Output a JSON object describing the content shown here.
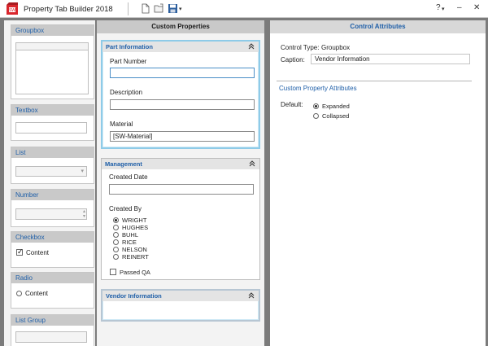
{
  "window": {
    "title": "Property Tab Builder  2018",
    "help_label": "?",
    "help_menu_label": "▾",
    "minimize_label": "–",
    "close_label": "✕"
  },
  "colors": {
    "accent": "#1f5fa8",
    "selection": "#8ecbe8",
    "logo": "#d9262c"
  },
  "palette": {
    "groupbox": {
      "label": "Groupbox"
    },
    "textbox": {
      "label": "Textbox"
    },
    "list": {
      "label": "List",
      "arrow": "▾"
    },
    "number": {
      "label": "Number",
      "spin_up": "▴",
      "spin_down": "▾"
    },
    "checkbox": {
      "label": "Checkbox",
      "item": "Content"
    },
    "radio": {
      "label": "Radio",
      "item": "Content"
    },
    "list_group": {
      "label": "List Group"
    }
  },
  "center": {
    "header": "Custom Properties",
    "part_information": {
      "title": "Part Information",
      "part_number_label": "Part Number",
      "part_number_value": "",
      "description_label": "Description",
      "description_value": "",
      "material_label": "Material",
      "material_value": "[SW-Material]"
    },
    "management": {
      "title": "Management",
      "created_date_label": "Created Date",
      "created_date_value": "",
      "created_by_label": "Created By",
      "options": [
        "WRIGHT",
        "HUGHES",
        "BUHL",
        "RICE",
        "NELSON",
        "REINERT"
      ],
      "selected_option": "WRIGHT",
      "passed_qa_label": "Passed QA",
      "passed_qa_checked": false
    },
    "vendor_information": {
      "title": "Vendor Information"
    }
  },
  "right": {
    "header": "Control Attributes",
    "control_type_label": "Control Type:",
    "control_type_value": "Groupbox",
    "caption_label": "Caption:",
    "caption_value": "Vendor Information",
    "custom_section_title": "Custom Property Attributes",
    "default_label": "Default:",
    "expanded_label": "Expanded",
    "collapsed_label": "Collapsed",
    "default_selected": "Expanded"
  }
}
